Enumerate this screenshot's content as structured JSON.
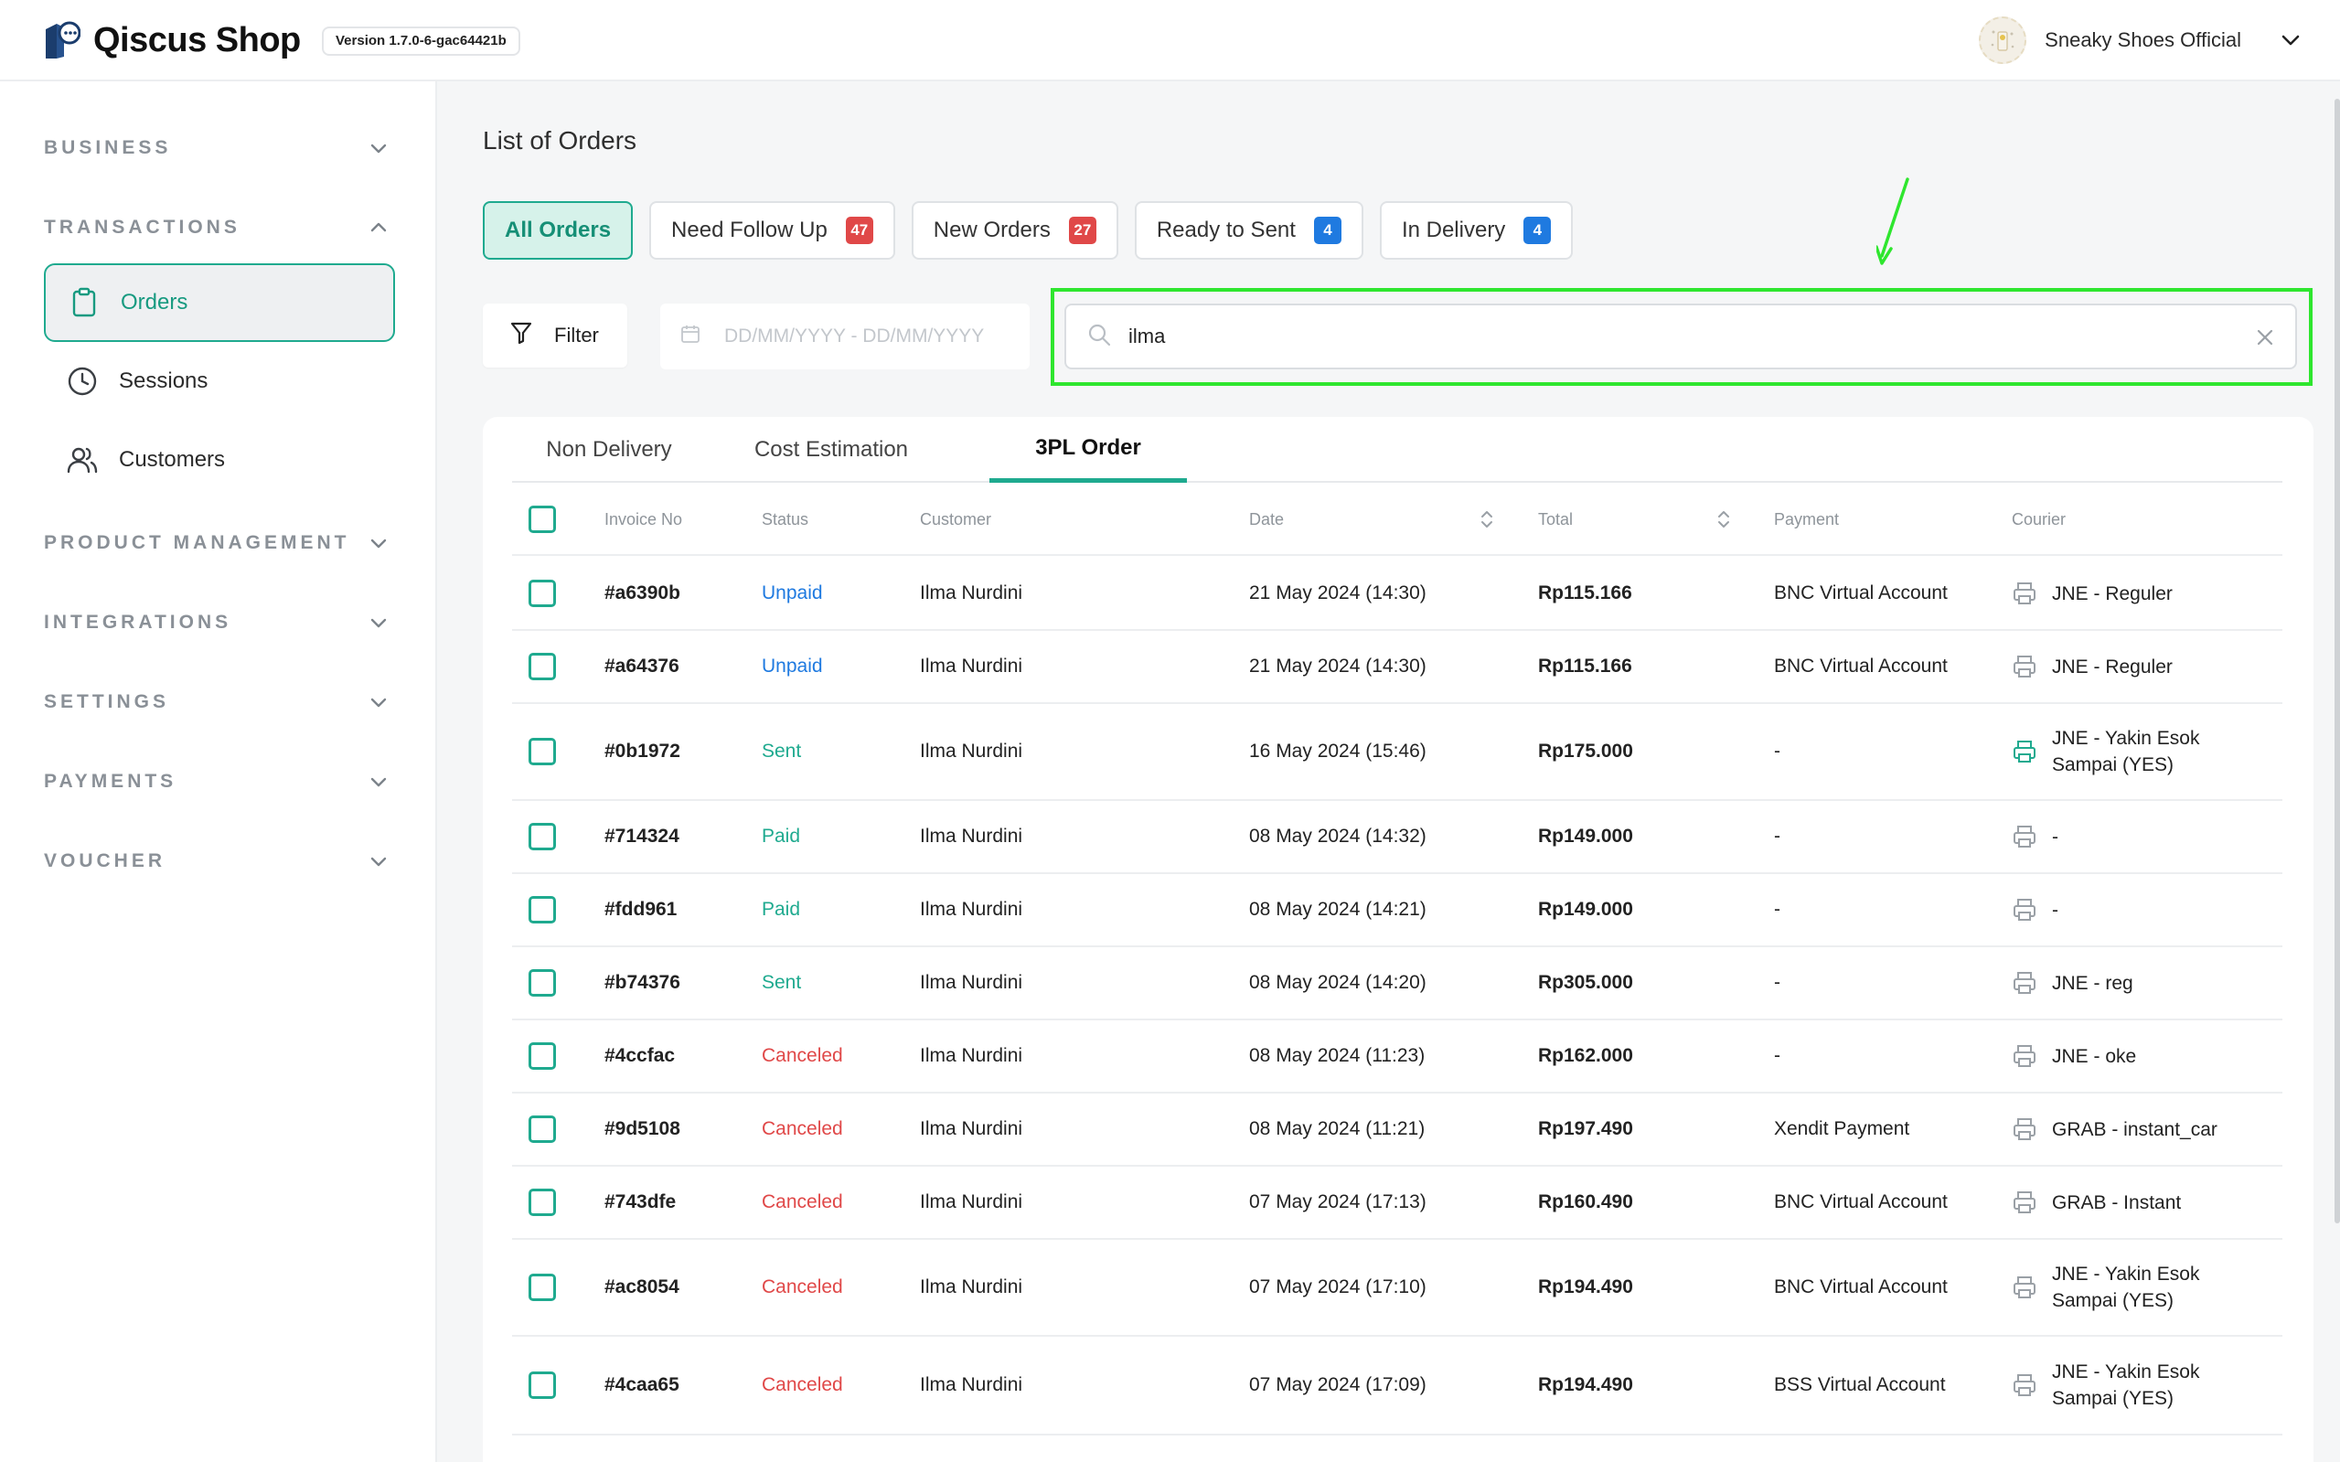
{
  "app": {
    "brand_name": "Qiscus Shop",
    "version": "Version 1.7.0-6-gac64421b",
    "user_name": "Sneaky Shoes Official"
  },
  "sidebar": {
    "sections": [
      {
        "label": "BUSINESS"
      },
      {
        "label": "TRANSACTIONS"
      },
      {
        "label": "PRODUCT MANAGEMENT"
      },
      {
        "label": "INTEGRATIONS"
      },
      {
        "label": "SETTINGS"
      },
      {
        "label": "PAYMENTS"
      },
      {
        "label": "VOUCHER"
      }
    ],
    "items": [
      {
        "label": "Orders",
        "icon": "clipboard-icon",
        "active": true
      },
      {
        "label": "Sessions",
        "icon": "clock-icon"
      },
      {
        "label": "Customers",
        "icon": "users-icon"
      }
    ]
  },
  "main": {
    "title": "List of Orders",
    "status_tabs": [
      {
        "label": "All Orders"
      },
      {
        "label": "Need Follow Up",
        "count": "47",
        "badge_color": "#e04848"
      },
      {
        "label": "New Orders",
        "count": "27",
        "badge_color": "#e04848"
      },
      {
        "label": "Ready to Sent",
        "count": "4",
        "badge_color": "#1f7ae0"
      },
      {
        "label": "In Delivery",
        "count": "4",
        "badge_color": "#1f7ae0"
      }
    ],
    "filter_label": "Filter",
    "date_placeholder": "DD/MM/YYYY - DD/MM/YYYY",
    "search_value": "ilma",
    "sub_tabs": [
      {
        "label": "Non Delivery"
      },
      {
        "label": "Cost Estimation"
      },
      {
        "label": "3PL Order",
        "active": true
      }
    ],
    "columns": [
      "Invoice No",
      "Status",
      "Customer",
      "Date",
      "Total",
      "Payment",
      "Courier"
    ],
    "rows": [
      {
        "invoice": "#a6390b",
        "status": "Unpaid",
        "customer": "Ilma Nurdini",
        "date": "21 May 2024 (14:30)",
        "total": "Rp115.166",
        "payment": "BNC Virtual Account",
        "courier": "JNE - Reguler"
      },
      {
        "invoice": "#a64376",
        "status": "Unpaid",
        "customer": "Ilma Nurdini",
        "date": "21 May 2024 (14:30)",
        "total": "Rp115.166",
        "payment": "BNC Virtual Account",
        "courier": "JNE - Reguler"
      },
      {
        "invoice": "#0b1972",
        "status": "Sent",
        "customer": "Ilma Nurdini",
        "date": "16 May 2024 (15:46)",
        "total": "Rp175.000",
        "payment": "-",
        "courier": "JNE - Yakin Esok Sampai (YES)"
      },
      {
        "invoice": "#714324",
        "status": "Paid",
        "customer": "Ilma Nurdini",
        "date": "08 May 2024 (14:32)",
        "total": "Rp149.000",
        "payment": "-",
        "courier": "-"
      },
      {
        "invoice": "#fdd961",
        "status": "Paid",
        "customer": "Ilma Nurdini",
        "date": "08 May 2024 (14:21)",
        "total": "Rp149.000",
        "payment": "-",
        "courier": "-"
      },
      {
        "invoice": "#b74376",
        "status": "Sent",
        "customer": "Ilma Nurdini",
        "date": "08 May 2024 (14:20)",
        "total": "Rp305.000",
        "payment": "-",
        "courier": "JNE - reg"
      },
      {
        "invoice": "#4ccfac",
        "status": "Canceled",
        "customer": "Ilma Nurdini",
        "date": "08 May 2024 (11:23)",
        "total": "Rp162.000",
        "payment": "-",
        "courier": "JNE - oke"
      },
      {
        "invoice": "#9d5108",
        "status": "Canceled",
        "customer": "Ilma Nurdini",
        "date": "08 May 2024 (11:21)",
        "total": "Rp197.490",
        "payment": "Xendit Payment",
        "courier": "GRAB - instant_car"
      },
      {
        "invoice": "#743dfe",
        "status": "Canceled",
        "customer": "Ilma Nurdini",
        "date": "07 May 2024 (17:13)",
        "total": "Rp160.490",
        "payment": "BNC Virtual Account",
        "courier": "GRAB - Instant"
      },
      {
        "invoice": "#ac8054",
        "status": "Canceled",
        "customer": "Ilma Nurdini",
        "date": "07 May 2024 (17:10)",
        "total": "Rp194.490",
        "payment": "BNC Virtual Account",
        "courier": "JNE - Yakin Esok Sampai (YES)"
      },
      {
        "invoice": "#4caa65",
        "status": "Canceled",
        "customer": "Ilma Nurdini",
        "date": "07 May 2024 (17:09)",
        "total": "Rp194.490",
        "payment": "BSS Virtual Account",
        "courier": "JNE - Yakin Esok Sampai (YES)"
      }
    ]
  },
  "colors": {
    "accent": "#1faa8f",
    "unpaid": "#1f7ae0",
    "canceled": "#e04848",
    "annotation": "#2ee62e"
  }
}
